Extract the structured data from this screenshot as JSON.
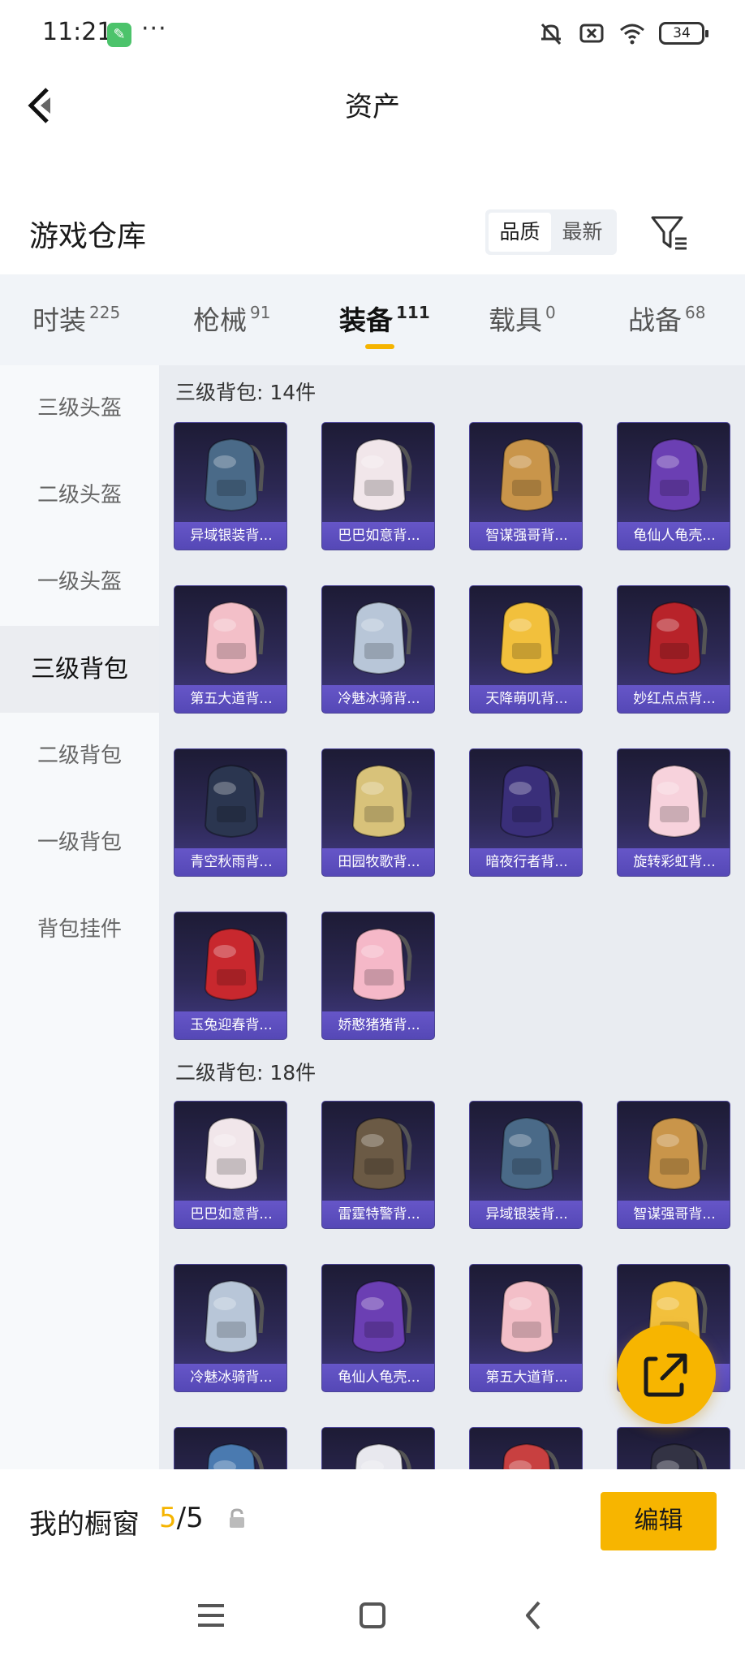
{
  "status_bar": {
    "time": "11:21",
    "more": "···",
    "battery": "34"
  },
  "header": {
    "title": "资产"
  },
  "warehouse": {
    "title": "游戏仓库",
    "sort_options": [
      {
        "label": "品质",
        "active": true
      },
      {
        "label": "最新",
        "active": false
      }
    ]
  },
  "tabs": [
    {
      "label": "时装",
      "count": "225",
      "active": false
    },
    {
      "label": "枪械",
      "count": "91",
      "active": false
    },
    {
      "label": "装备",
      "count": "111",
      "active": true
    },
    {
      "label": "载具",
      "count": "0",
      "active": false
    },
    {
      "label": "战备",
      "count": "68",
      "active": false
    }
  ],
  "sidebar": {
    "items": [
      {
        "label": "三级头盔",
        "active": false
      },
      {
        "label": "二级头盔",
        "active": false
      },
      {
        "label": "一级头盔",
        "active": false
      },
      {
        "label": "三级背包",
        "active": true
      },
      {
        "label": "二级背包",
        "active": false
      },
      {
        "label": "一级背包",
        "active": false
      },
      {
        "label": "背包挂件",
        "active": false
      }
    ]
  },
  "sections": [
    {
      "title": "三级背包: 14件",
      "items": [
        {
          "name": "异域银装背...",
          "icon": "silver-tech-backpack",
          "color": "#4a6a88"
        },
        {
          "name": "巴巴如意背...",
          "icon": "white-bunny-backpack",
          "color": "#f1e6ea"
        },
        {
          "name": "智谋强哥背...",
          "icon": "hamster-backpack",
          "color": "#c9954a"
        },
        {
          "name": "龟仙人龟壳...",
          "icon": "turtle-shell-backpack",
          "color": "#6b3fb3"
        },
        {
          "name": "第五大道背...",
          "icon": "pink-quilted-backpack",
          "color": "#f3bfc8"
        },
        {
          "name": "冷魅冰骑背...",
          "icon": "ice-knight-backpack",
          "color": "#b8c6d8"
        },
        {
          "name": "天降萌叽背...",
          "icon": "yellow-backpack",
          "color": "#f2c03c"
        },
        {
          "name": "妙红点点背...",
          "icon": "ladybug-backpack",
          "color": "#b8232a"
        },
        {
          "name": "青空秋雨背...",
          "icon": "dark-ornate-backpack",
          "color": "#2b3650"
        },
        {
          "name": "田园牧歌背...",
          "icon": "flower-basket-backpack",
          "color": "#d8c27a"
        },
        {
          "name": "暗夜行者背...",
          "icon": "neon-face-backpack",
          "color": "#3a2f7a"
        },
        {
          "name": "旋转彩虹背...",
          "icon": "cake-backpack",
          "color": "#f7d2dc"
        },
        {
          "name": "玉兔迎春背...",
          "icon": "red-rabbit-backpack",
          "color": "#c8282e"
        },
        {
          "name": "娇憨猪猪背...",
          "icon": "pink-pig-backpack",
          "color": "#f5b8c8"
        }
      ]
    },
    {
      "title": "二级背包: 18件",
      "items": [
        {
          "name": "巴巴如意背...",
          "icon": "white-bunny-backpack",
          "color": "#f1e6ea"
        },
        {
          "name": "雷霆特警背...",
          "icon": "camo-backpack",
          "color": "#6b5a45"
        },
        {
          "name": "异域银装背...",
          "icon": "silver-tech-backpack",
          "color": "#4a6a88"
        },
        {
          "name": "智谋强哥背...",
          "icon": "hamster-backpack",
          "color": "#c9954a"
        },
        {
          "name": "冷魅冰骑背...",
          "icon": "ice-knight-backpack",
          "color": "#b8c6d8"
        },
        {
          "name": "龟仙人龟壳...",
          "icon": "turtle-shell-backpack",
          "color": "#6b3fb3"
        },
        {
          "name": "第五大道背...",
          "icon": "pink-quilted-backpack",
          "color": "#f3bfc8"
        },
        {
          "name": "",
          "icon": "yellow-backpack",
          "color": "#f2c03c"
        },
        {
          "name": "",
          "icon": "blue-backpack",
          "color": "#4a7ab0"
        },
        {
          "name": "",
          "icon": "white-backpack",
          "color": "#e8e8ee"
        },
        {
          "name": "",
          "icon": "red-strap-backpack",
          "color": "#c84040"
        },
        {
          "name": "",
          "icon": "dark-backpack",
          "color": "#333344"
        }
      ]
    }
  ],
  "showcase": {
    "title": "我的橱窗",
    "count_current": "5",
    "count_sep": "/",
    "count_total": "5",
    "edit_label": "编辑"
  },
  "colors": {
    "accent": "#f7b500",
    "card_bg": "#2d2955",
    "label_bg": "#5e50c0"
  }
}
